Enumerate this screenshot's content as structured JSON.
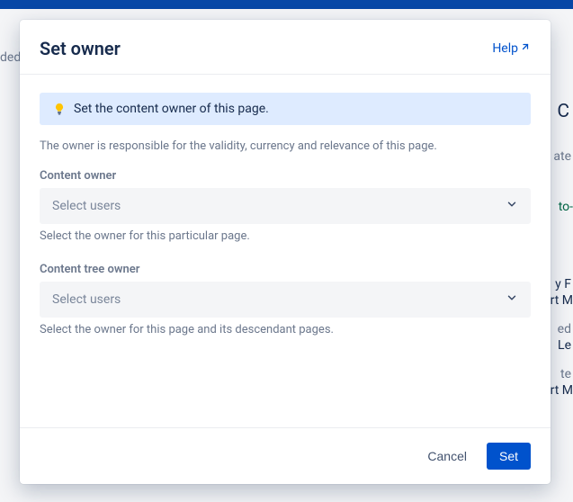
{
  "modal": {
    "title": "Set owner",
    "help_label": "Help",
    "callout": "Set the content owner of this page.",
    "description": "The owner is responsible for the validity, currency and relevance of this page.",
    "fields": {
      "content_owner": {
        "label": "Content owner",
        "placeholder": "Select users",
        "help": "Select the owner for this particular page."
      },
      "content_tree_owner": {
        "label": "Content tree owner",
        "placeholder": "Select users",
        "help": "Select the owner for this page and its descendant pages."
      }
    },
    "actions": {
      "cancel": "Cancel",
      "set": "Set"
    }
  },
  "background": {
    "left_fragment": "ded",
    "right1": "C",
    "right2": "ate",
    "right3": "to-",
    "right4": "y F",
    "right5": "rt M",
    "right6": "ed",
    "right7": "Le",
    "right8": "te",
    "right9": "rt M"
  }
}
